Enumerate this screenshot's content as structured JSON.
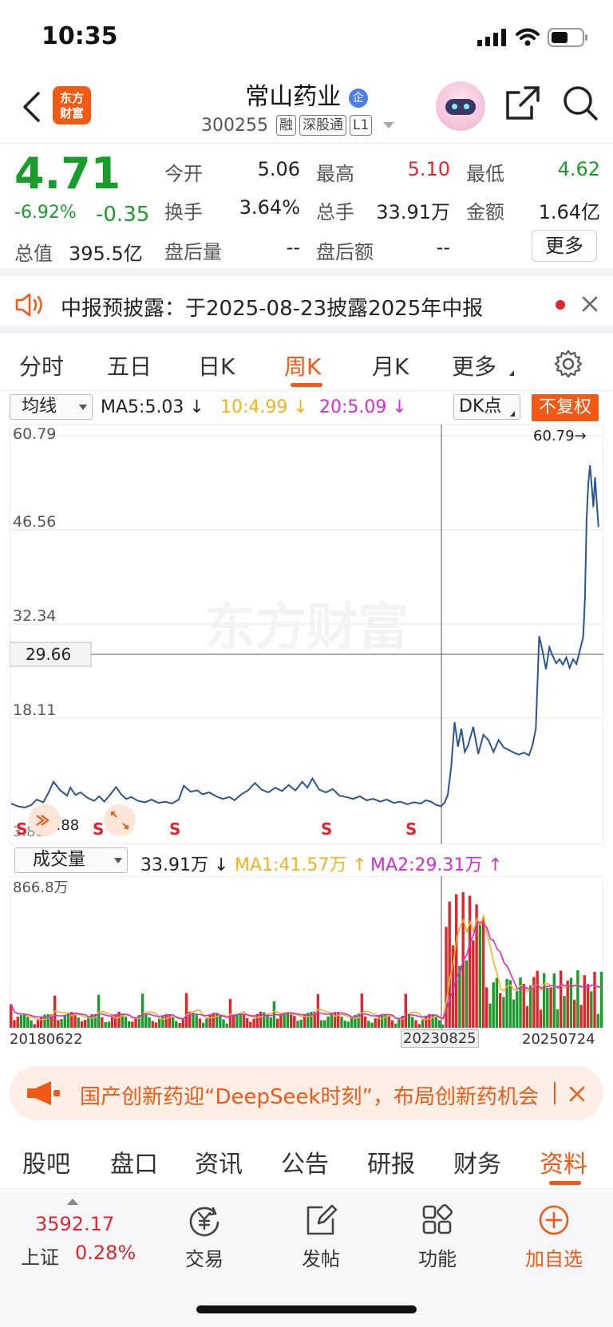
{
  "status_bar": {
    "time": "10:35"
  },
  "header": {
    "logo_text_line1": "东方",
    "logo_text_line2": "财富",
    "stock_name": "常山药业",
    "badge": "企",
    "stock_code": "300255",
    "tags": [
      "融",
      "深股通",
      "L1"
    ]
  },
  "quote": {
    "price": "4.71",
    "change_pct": "-6.92%",
    "change_amt": "-0.35",
    "market_cap_label": "总值",
    "market_cap": "395.5亿",
    "fields": [
      {
        "label": "今开",
        "value": "5.06",
        "color": "#222222"
      },
      {
        "label": "最高",
        "value": "5.10",
        "color": "#e0262b"
      },
      {
        "label": "最低",
        "value": "4.62",
        "color": "#1a9c2c"
      },
      {
        "label": "换手",
        "value": "3.64%",
        "color": "#222222"
      },
      {
        "label": "总手",
        "value": "33.91万",
        "color": "#222222"
      },
      {
        "label": "金额",
        "value": "1.64亿",
        "color": "#222222"
      },
      {
        "label": "盘后量",
        "value": "--",
        "color": "#222222"
      },
      {
        "label": "盘后额",
        "value": "--",
        "color": "#222222"
      }
    ],
    "more_button": "更多"
  },
  "notice": {
    "text": "中报预披露：于2025-08-23披露2025年中报"
  },
  "chart_tabs": {
    "tabs": [
      "分时",
      "五日",
      "日K",
      "周K",
      "月K",
      "更多"
    ],
    "active": "周K"
  },
  "ma_row": {
    "select_label": "均线",
    "ma5": "MA5:5.03",
    "ma10": "10:4.99",
    "ma20": "20:5.09",
    "dk_button": "DK点",
    "adjust_button": "不复权"
  },
  "colors": {
    "accent": "#f05a14",
    "up": "#e0262b",
    "down": "#1a9c2c",
    "line": "#2c5590",
    "ma1": "#f2b21b",
    "ma2": "#d62bd6"
  },
  "chart_data": [
    {
      "type": "line",
      "y_ticks": [
        "60.79",
        "46.56",
        "32.34",
        "18.11"
      ],
      "y_labels_extra": [
        "3.88"
      ],
      "crosshair_value": "29.66",
      "max_label": "60.79",
      "min_label": "3.88",
      "watermark": "东方财富",
      "ylim": [
        3.88,
        60.79
      ],
      "x_labels": [
        "20180622",
        "20230825",
        "20250724"
      ],
      "markers": [
        "S",
        "S",
        "S",
        "S",
        "S"
      ],
      "x": [
        0,
        8,
        16,
        24,
        30,
        38,
        44,
        50,
        58,
        66,
        70,
        76,
        82,
        90,
        98,
        104,
        110,
        116,
        124,
        130,
        136,
        142,
        150,
        158,
        166,
        174,
        182,
        190,
        198,
        204,
        212,
        220,
        226,
        234,
        242,
        250,
        258,
        264,
        272,
        280,
        288,
        296,
        304,
        312,
        320,
        328,
        336,
        344,
        350,
        356,
        364,
        372,
        380,
        388,
        396,
        404,
        412,
        420,
        428,
        436,
        444,
        452,
        460,
        468,
        476,
        484,
        490,
        496,
        502,
        508,
        512,
        516,
        520,
        524,
        528,
        532,
        536,
        540,
        546,
        552,
        558,
        564,
        570,
        576,
        582,
        588,
        594,
        600,
        606,
        612,
        616,
        620,
        624,
        628,
        632,
        636,
        640,
        644,
        648,
        652,
        656,
        660,
        664,
        668,
        672,
        676,
        678,
        680,
        682,
        684,
        686,
        688,
        690,
        692,
        694,
        696,
        698
      ],
      "values": [
        5.2,
        4.8,
        4.6,
        5.0,
        5.8,
        5.4,
        6.8,
        8.5,
        7.2,
        6.4,
        7.6,
        6.5,
        6.9,
        6.1,
        5.6,
        6.3,
        5.5,
        6.4,
        7.7,
        6.6,
        5.9,
        6.2,
        5.6,
        5.4,
        5.8,
        5.3,
        5.5,
        5.2,
        5.8,
        7.9,
        7.0,
        7.2,
        6.6,
        6.9,
        6.3,
        5.9,
        6.2,
        5.7,
        6.6,
        7.2,
        8.3,
        7.3,
        6.9,
        7.6,
        7.1,
        8.0,
        7.2,
        8.5,
        7.6,
        9.0,
        7.3,
        6.9,
        7.4,
        6.4,
        6.2,
        5.9,
        6.3,
        5.7,
        5.9,
        5.5,
        5.8,
        5.3,
        5.5,
        5.1,
        5.4,
        5.2,
        5.7,
        5.5,
        5.0,
        4.8,
        5.3,
        6.5,
        10.8,
        17.5,
        13.8,
        16.5,
        13.0,
        14.0,
        16.8,
        12.7,
        15.6,
        14.8,
        13.0,
        14.8,
        13.7,
        13.3,
        12.9,
        12.6,
        12.9,
        12.5,
        14.0,
        16.5,
        30.5,
        28.2,
        25.5,
        28.8,
        27.5,
        26.4,
        27.0,
        26.2,
        27.3,
        25.7,
        27.0,
        26.3,
        28.3,
        30.4,
        36.0,
        48.0,
        53.5,
        56.3,
        53.3,
        50.0,
        54.5,
        50.8,
        47.0
      ]
    },
    {
      "type": "bar",
      "title": "成交量",
      "current_value": "33.91万",
      "ma1": "MA1:41.57万",
      "ma2": "MA2:29.31万",
      "y_max_label": "866.8万",
      "ylim": [
        0,
        866.8
      ],
      "unit": "万"
    }
  ],
  "banner": {
    "text": "国产创新药迎“DeepSeek时刻”，布局创新药机会"
  },
  "info_tabs": {
    "tabs": [
      "股吧",
      "盘口",
      "资讯",
      "公告",
      "研报",
      "财务",
      "资料"
    ],
    "active": "资料"
  },
  "toolbar": {
    "index_value": "3592.17",
    "index_name": "上证",
    "index_change": "0.28%",
    "items": [
      {
        "label": "交易",
        "icon": "trade-yen-icon"
      },
      {
        "label": "发帖",
        "icon": "edit-post-icon"
      },
      {
        "label": "功能",
        "icon": "grid-apps-icon"
      },
      {
        "label": "加自选",
        "icon": "add-circle-icon"
      }
    ]
  }
}
